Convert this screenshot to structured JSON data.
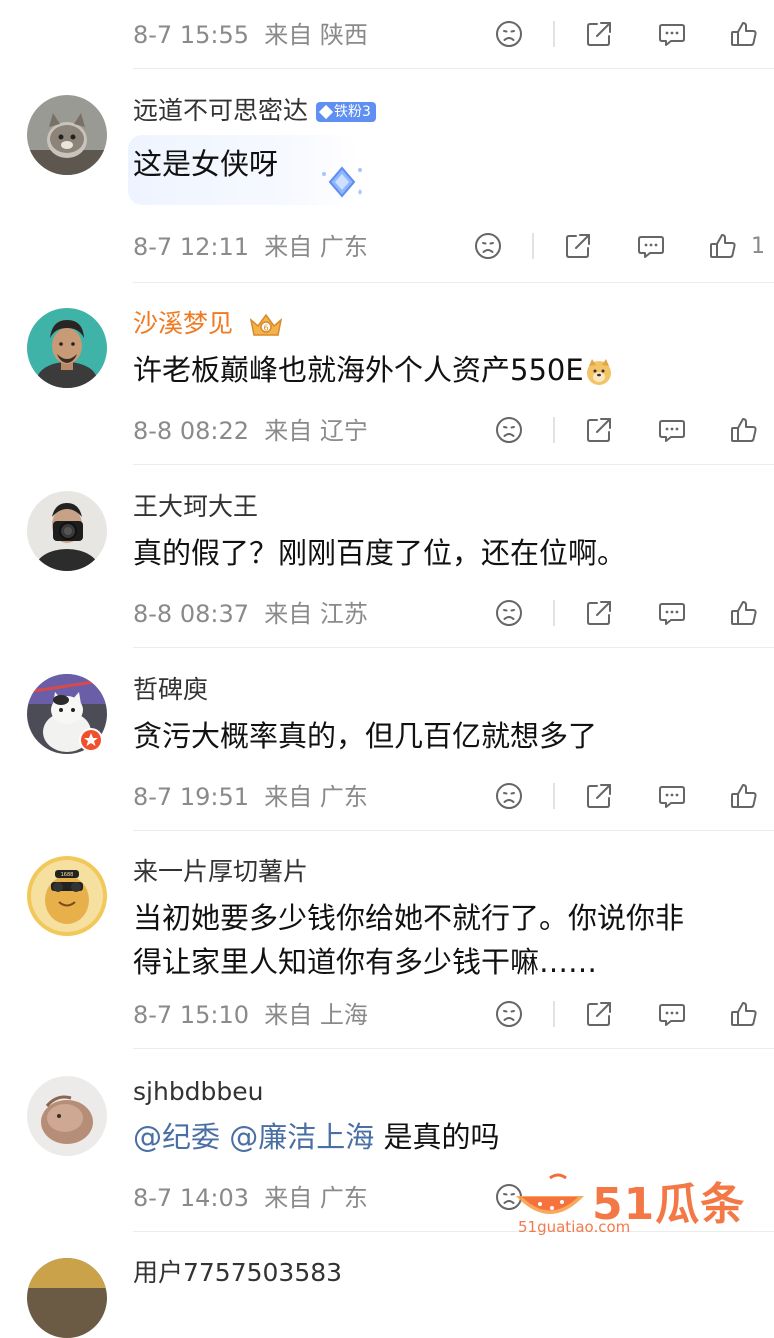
{
  "top_meta": {
    "time": "8-7 15:55",
    "location": "来自 陕西"
  },
  "comments": [
    {
      "username": "远道不可思密达",
      "badge": "铁粉3",
      "content": "这是女侠呀",
      "time": "8-7 12:11",
      "location": "来自 广东",
      "likes": "1"
    },
    {
      "username": "沙溪梦见",
      "content": "许老板巅峰也就海外个人资产550E",
      "time": "8-8 08:22",
      "location": "来自 辽宁"
    },
    {
      "username": "王大珂大王",
      "content": "真的假了？刚刚百度了位，还在位啊。",
      "time": "8-8 08:37",
      "location": "来自 江苏"
    },
    {
      "username": "哲碑庾",
      "content": "贪污大概率真的，但几百亿就想多了",
      "time": "8-7 19:51",
      "location": "来自 广东"
    },
    {
      "username": "来一片厚切薯片",
      "content_line1": "当初她要多少钱你给她不就行了。你说你非",
      "content_line2": "得让家里人知道你有多少钱干嘛……",
      "time": "8-7 15:10",
      "location": "来自 上海"
    },
    {
      "username": "sjhbdbbeu",
      "mention1": "@纪委",
      "mention2": "@廉洁上海",
      "content_rest": " 是真的吗",
      "time": "8-7 14:03",
      "location": "来自 广东"
    },
    {
      "username": "用户7757503583"
    }
  ],
  "watermark": {
    "brand": "51瓜条",
    "url": "51guatiao.com"
  },
  "colors": {
    "meta": "#8a8a8a",
    "mention": "#4a6fa5",
    "vip_name": "#f07a22",
    "badge": "#5f8ff0"
  },
  "icons": [
    "dislike-face-icon",
    "share-icon",
    "comment-icon",
    "like-thumb-icon"
  ]
}
